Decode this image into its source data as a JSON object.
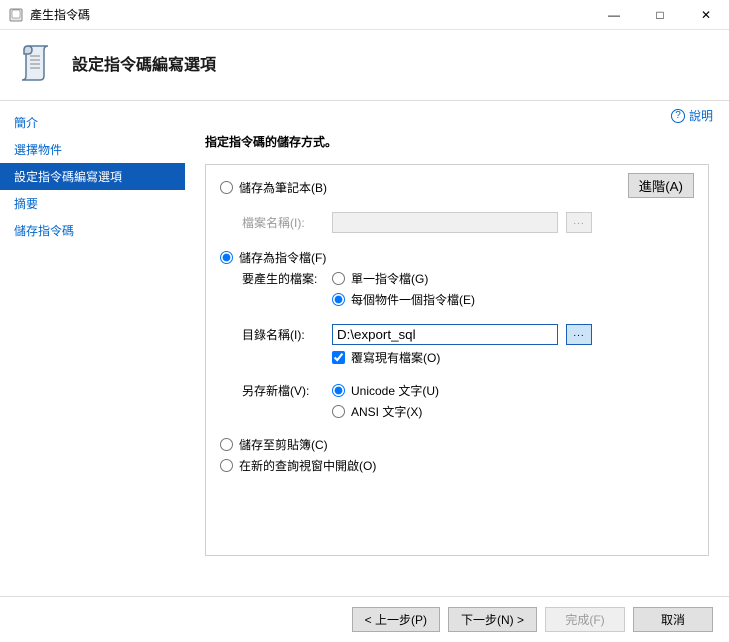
{
  "window": {
    "title": "產生指令碼",
    "minimize": "—",
    "maximize": "□",
    "close": "✕"
  },
  "header": {
    "heading": "設定指令碼編寫選項"
  },
  "sidebar": {
    "items": [
      {
        "label": "簡介"
      },
      {
        "label": "選擇物件"
      },
      {
        "label": "設定指令碼編寫選項"
      },
      {
        "label": "摘要"
      },
      {
        "label": "儲存指令碼"
      }
    ]
  },
  "help": {
    "label": "說明"
  },
  "section": {
    "title": "指定指令碼的儲存方式。"
  },
  "panel": {
    "advanced": "進階(A)",
    "saveNotebook": "儲存為筆記本(B)",
    "filenameLabel": "檔案名稱(I):",
    "saveScriptFile": "儲存為指令檔(F)",
    "filesToGenerate": "要產生的檔案:",
    "singleFile": "單一指令檔(G)",
    "perObject": "每個物件一個指令檔(E)",
    "dirLabel": "目錄名稱(I):",
    "dirValue": "D:\\export_sql",
    "overwrite": "覆寫現有檔案(O)",
    "saveAsLabel": "另存新檔(V):",
    "unicode": "Unicode 文字(U)",
    "ansi": "ANSI 文字(X)",
    "clipboard": "儲存至剪貼簿(C)",
    "newQuery": "在新的查詢視窗中開啟(O)"
  },
  "footer": {
    "prev": "< 上一步(P)",
    "next": "下一步(N) >",
    "finish": "完成(F)",
    "cancel": "取消"
  }
}
